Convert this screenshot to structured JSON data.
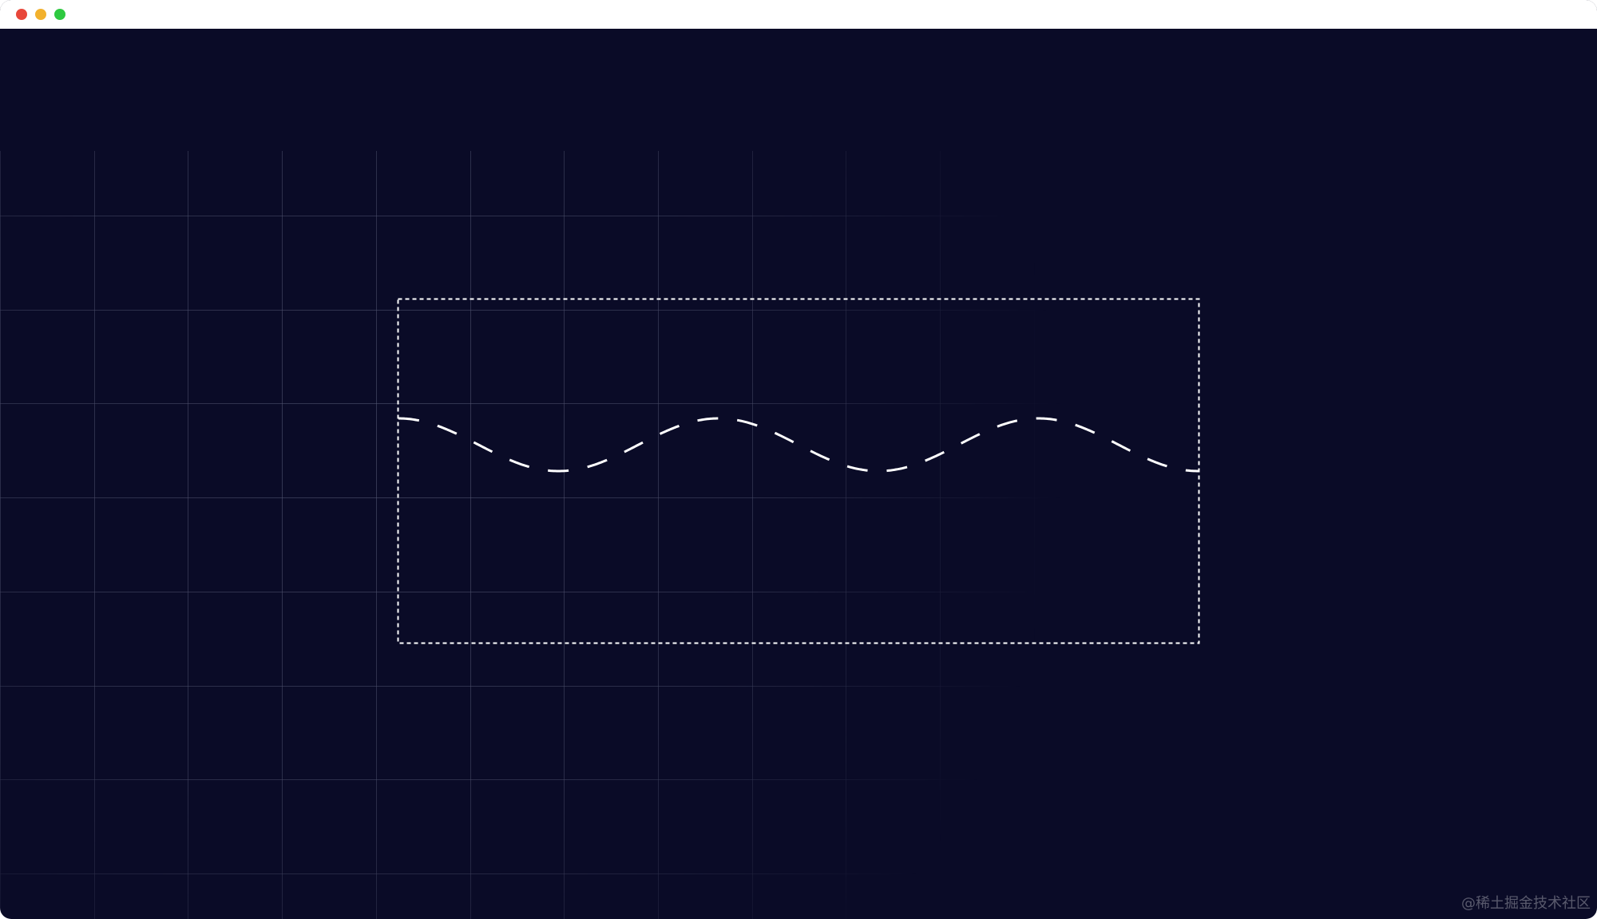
{
  "window": {
    "background": "#0a0b27",
    "controls": [
      {
        "name": "close",
        "color": "#e8473a"
      },
      {
        "name": "minimize",
        "color": "#f2b12d"
      },
      {
        "name": "zoom",
        "color": "#2ec940"
      }
    ]
  },
  "canvas": {
    "grid_color": "#5a5c78",
    "frame": {
      "style": "dashed",
      "color": "#ffffff"
    },
    "wave": {
      "style": "dashed",
      "color": "#ffffff",
      "periods": 2.5
    }
  },
  "watermark": {
    "text": "@稀土掘金技术社区"
  }
}
